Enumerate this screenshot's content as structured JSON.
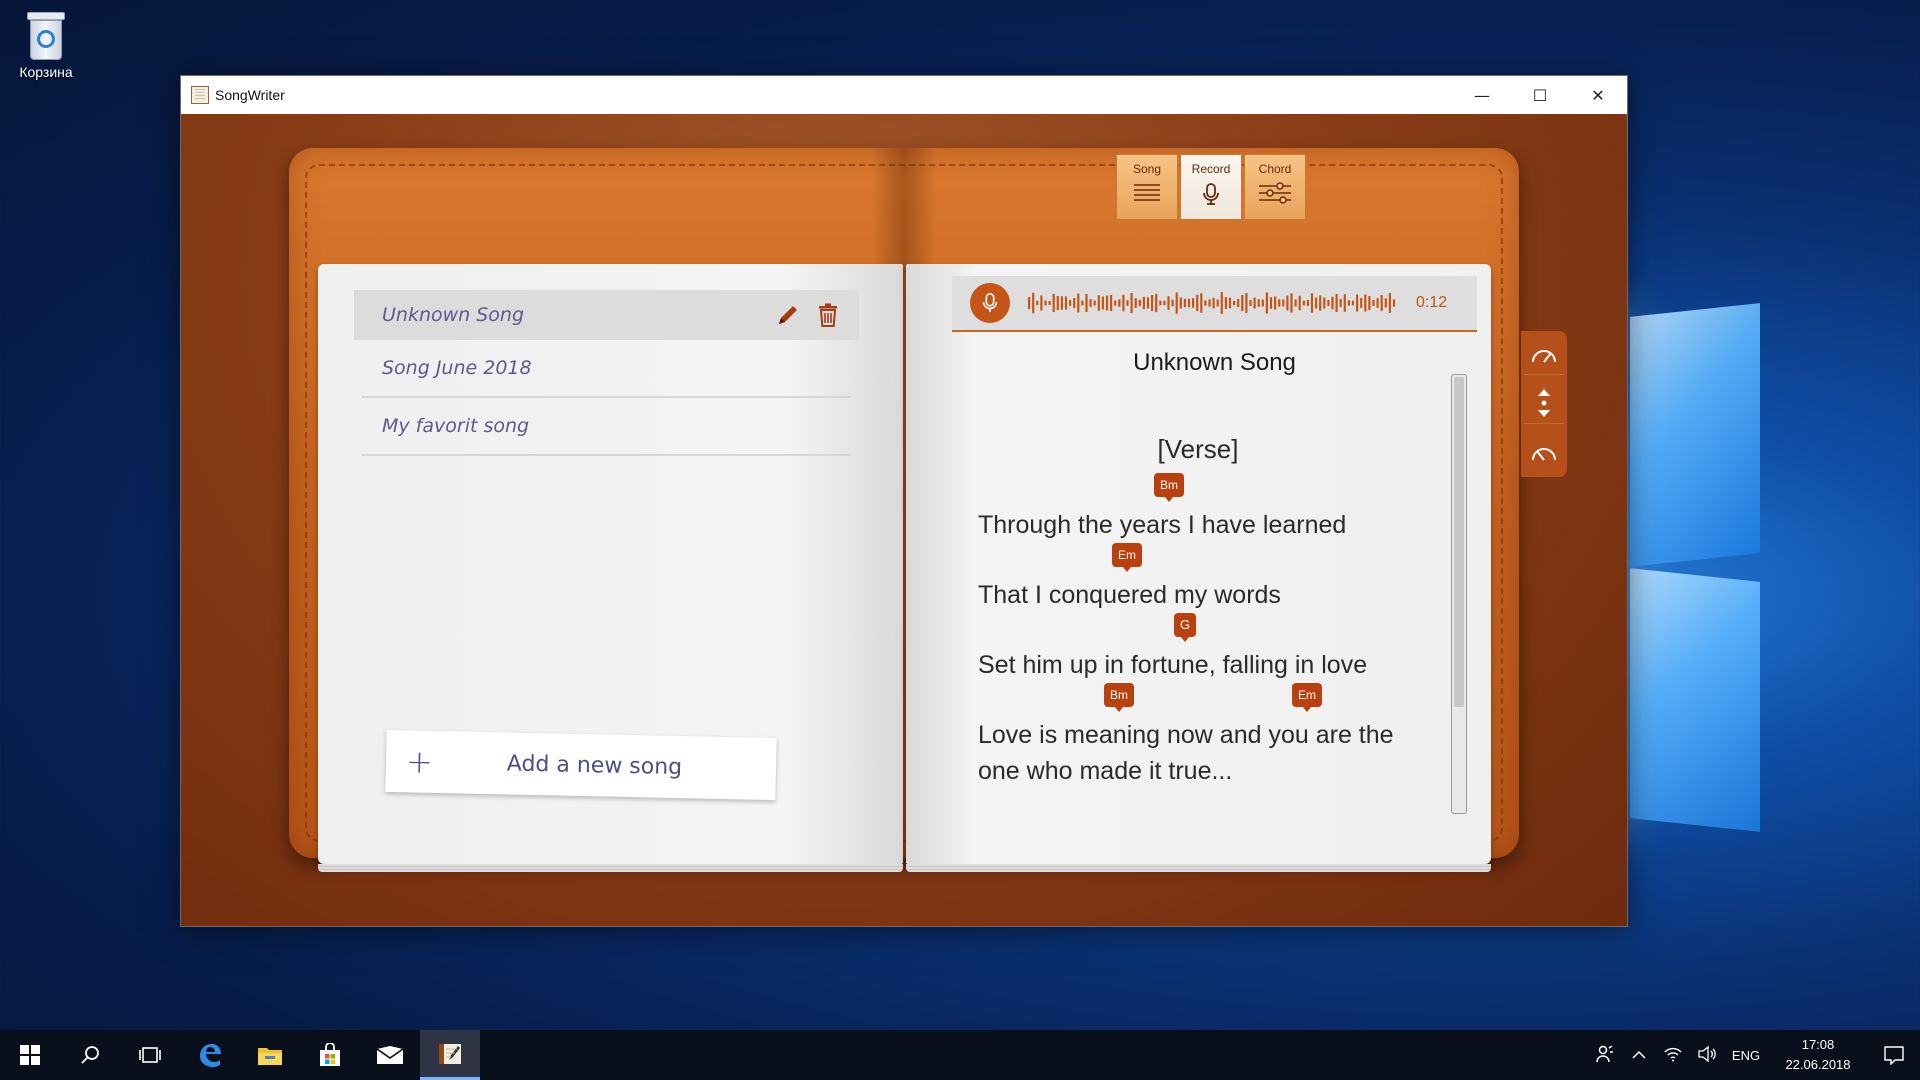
{
  "desktop": {
    "recycle_bin_label": "Корзина"
  },
  "window": {
    "title": "SongWriter",
    "minimize_glyph": "—",
    "maximize_glyph": "☐",
    "close_glyph": "✕"
  },
  "tabs": [
    {
      "label": "Song",
      "icon": "lines-icon",
      "active": false
    },
    {
      "label": "Record",
      "icon": "microphone-icon",
      "active": true
    },
    {
      "label": "Chord",
      "icon": "sliders-icon",
      "active": false
    }
  ],
  "song_list": {
    "items": [
      {
        "title": "Unknown Song",
        "selected": true
      },
      {
        "title": "Song June 2018",
        "selected": false
      },
      {
        "title": "My favorit song",
        "selected": false
      }
    ],
    "add_plus": "+",
    "add_label": "Add a new song"
  },
  "recorder": {
    "time": "0:12"
  },
  "song": {
    "title": "Unknown Song",
    "section": "[Verse]",
    "lines": [
      {
        "text": "Through the years I have learned",
        "chords": [
          "Bm"
        ]
      },
      {
        "text": "That I conquered my words",
        "chords": [
          "Em"
        ]
      },
      {
        "text": "Set him up in fortune, falling in love",
        "chords": [
          "G"
        ]
      },
      {
        "text": "Love is meaning now and you are the one who made it true...",
        "chords": [
          "Bm",
          "Em"
        ]
      }
    ]
  },
  "taskbar": {
    "language": "ENG",
    "time": "17:08",
    "date": "22.06.2018"
  },
  "colors": {
    "accent": "#c55417",
    "chord_bg": "#b8410f",
    "list_text": "#5c5a8e"
  }
}
